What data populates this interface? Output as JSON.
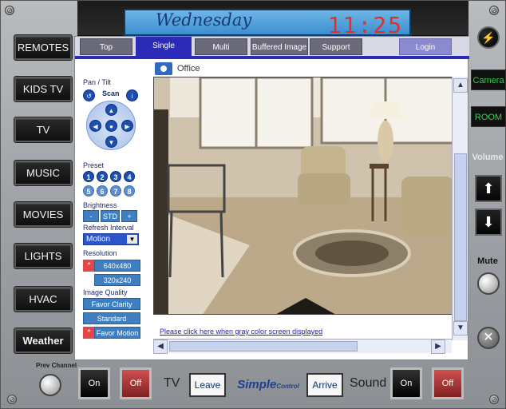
{
  "left_menu": [
    "REMOTES",
    "KIDS TV",
    "TV",
    "MUSIC",
    "MOVIES",
    "LIGHTS",
    "HVAC",
    "Weather"
  ],
  "display": {
    "day": "Wednesday",
    "time": "11:25"
  },
  "tabs": [
    {
      "label": "Top"
    },
    {
      "label": "Single"
    },
    {
      "label": "Multi"
    },
    {
      "label": "Buffered Image"
    },
    {
      "label": "Support"
    },
    {
      "label": "Login"
    }
  ],
  "camera": {
    "location": "Office"
  },
  "controls": {
    "pan_tilt": "Pan / Tilt",
    "scan": "Scan",
    "preset_label": "Preset",
    "presets": [
      "1",
      "2",
      "3",
      "4",
      "5",
      "6",
      "7",
      "8"
    ],
    "brightness_label": "Brightness",
    "brightness_minus": "-",
    "brightness_std": "STD",
    "brightness_plus": "+",
    "refresh_label": "Refresh Interval",
    "refresh_value": "Motion",
    "resolution_label": "Resolution",
    "res_high": "640x480",
    "res_low": "320x240",
    "quality_label": "Image Quality",
    "quality_clarity": "Favor Clarity",
    "quality_standard": "Standard",
    "quality_motion": "Favor Motion"
  },
  "gray_link": "Please click here when gray color screen displayed",
  "right_panel": {
    "camera": "Camera",
    "room": "ROOM",
    "volume": "Volume",
    "mute": "Mute"
  },
  "bottom": {
    "prev_channel": "Prev Channel",
    "tv_on": "On",
    "tv_off": "Off",
    "tv_label": "TV",
    "leave": "Leave",
    "logo": "Simple",
    "logo_suffix": "Control",
    "arrive": "Arrive",
    "sound_label": "Sound",
    "sound_on": "On",
    "sound_off": "Off"
  }
}
